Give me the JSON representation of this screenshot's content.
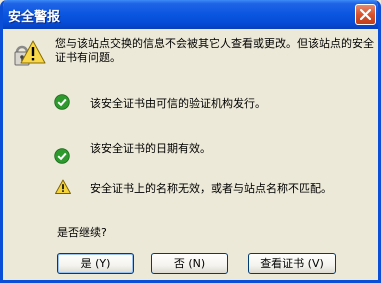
{
  "window": {
    "title": "安全警报"
  },
  "message": "您与该站点交换的信息不会被其它人查看或更改。但该站点的安全证书有问题。",
  "checks": [
    {
      "status": "ok",
      "text": "该安全证书由可信的验证机构发行。"
    },
    {
      "status": "ok",
      "text": "该安全证书的日期有效。"
    },
    {
      "status": "warning",
      "text": "安全证书上的名称无效，或者与站点名称不匹配。"
    }
  ],
  "prompt": "是否继续?",
  "buttons": {
    "yes": "是 (Y)",
    "no": "否 (N)",
    "view_cert": "查看证书 (V)"
  },
  "colors": {
    "titlebar": "#0a56e0",
    "window_bg": "#ece9d8",
    "ok": "#2e9a2e",
    "warning": "#f5d33a"
  }
}
